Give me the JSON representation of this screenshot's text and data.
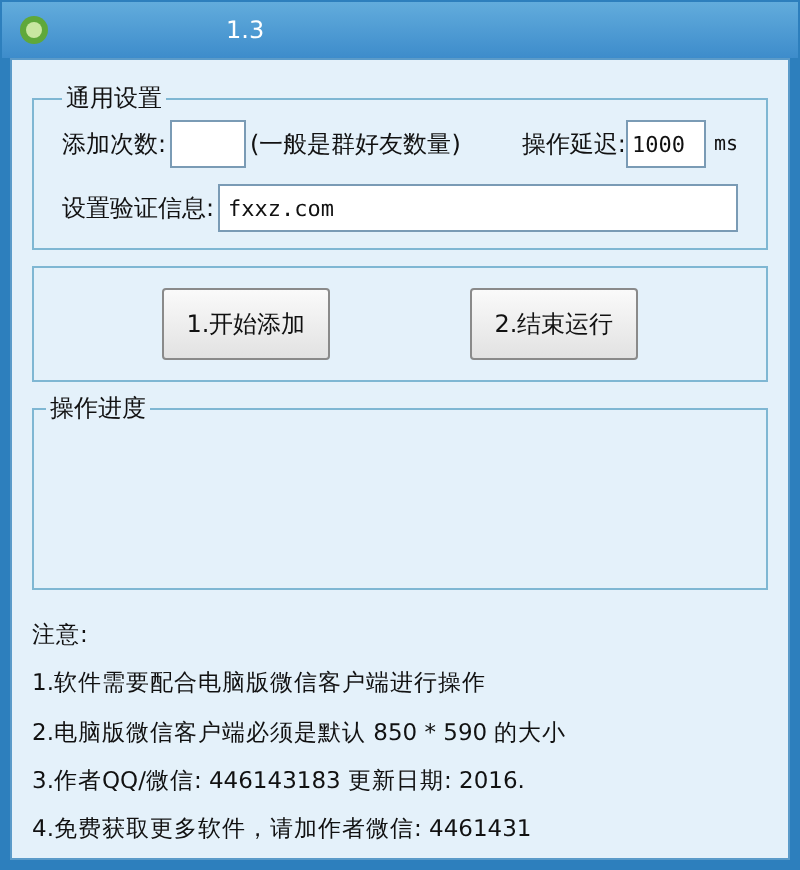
{
  "window": {
    "title": "1.3"
  },
  "general": {
    "title": "通用设置",
    "count_label": "添加次数:",
    "count_hint": "(一般是群好友数量)",
    "delay_label": "操作延迟:",
    "delay_value": "1000",
    "delay_unit": "ms",
    "verify_label": "设置验证信息:",
    "verify_value": "fxxz.com"
  },
  "buttons": [
    "1.开始添加",
    "2.结束运行"
  ],
  "progress": {
    "title": "操作进度"
  },
  "notes": {
    "title": "注意:",
    "lines": [
      "1.软件需要配合电脑版微信客户端进行操作",
      "2.电脑版微信客户端必须是默认 850 * 590 的大小",
      "3.作者QQ/微信: 446143183 更新日期: 2016.",
      "4.免费获取更多软件，请加作者微信: 4461431"
    ]
  }
}
